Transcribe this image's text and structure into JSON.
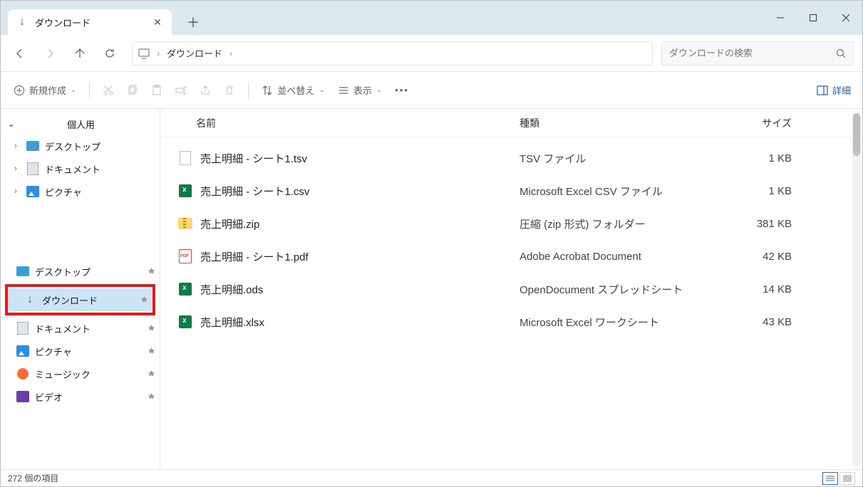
{
  "titlebar": {
    "tab_title": "ダウンロード",
    "tab_icon": "download"
  },
  "nav": {
    "breadcrumb": [
      "ダウンロード"
    ],
    "search_placeholder": "ダウンロードの検索"
  },
  "toolbar": {
    "new_label": "新規作成",
    "sort_label": "並べ替え",
    "view_label": "表示",
    "details_label": "詳細"
  },
  "sidebar": {
    "personal_label": "個人用",
    "personal": [
      {
        "label": "デスクトップ",
        "icon": "desktop"
      },
      {
        "label": "ドキュメント",
        "icon": "document"
      },
      {
        "label": "ピクチャ",
        "icon": "picture"
      }
    ],
    "quick": [
      {
        "label": "デスクトップ",
        "icon": "desktop",
        "pinned": true
      },
      {
        "label": "ダウンロード",
        "icon": "download",
        "pinned": true,
        "selected": true,
        "highlighted": true
      },
      {
        "label": "ドキュメント",
        "icon": "document",
        "pinned": true
      },
      {
        "label": "ピクチャ",
        "icon": "picture",
        "pinned": true
      },
      {
        "label": "ミュージック",
        "icon": "music",
        "pinned": true
      },
      {
        "label": "ビデオ",
        "icon": "video",
        "pinned": true
      }
    ]
  },
  "columns": {
    "name": "名前",
    "type": "種類",
    "size": "サイズ"
  },
  "files": [
    {
      "name": "売上明細 - シート1.tsv",
      "type": "TSV ファイル",
      "size": "1 KB",
      "icon": "blank"
    },
    {
      "name": "売上明細 - シート1.csv",
      "type": "Microsoft Excel CSV ファイル",
      "size": "1 KB",
      "icon": "xls"
    },
    {
      "name": "売上明細.zip",
      "type": "圧縮 (zip 形式) フォルダー",
      "size": "381 KB",
      "icon": "zip"
    },
    {
      "name": "売上明細 - シート1.pdf",
      "type": "Adobe Acrobat Document",
      "size": "42 KB",
      "icon": "pdf"
    },
    {
      "name": "売上明細.ods",
      "type": "OpenDocument スプレッドシート",
      "size": "14 KB",
      "icon": "xls"
    },
    {
      "name": "売上明細.xlsx",
      "type": "Microsoft Excel ワークシート",
      "size": "43 KB",
      "icon": "xls"
    }
  ],
  "status": {
    "count_label": "272 個の項目"
  }
}
